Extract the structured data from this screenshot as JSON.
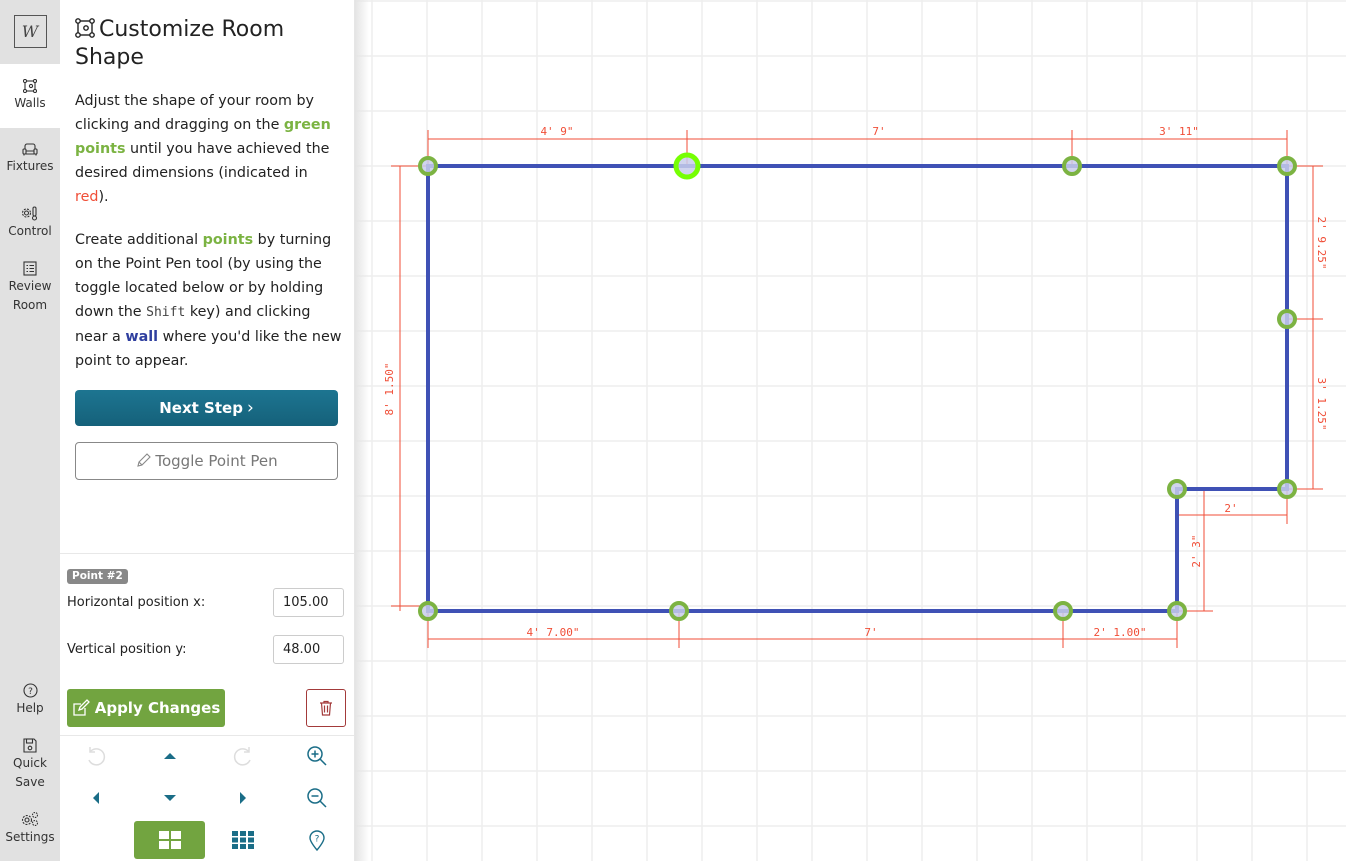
{
  "rail": {
    "logo_text": "W",
    "items": [
      {
        "label": "Walls",
        "icon": "walls-icon",
        "active": true
      },
      {
        "label": "Fixtures",
        "icon": "sofa-icon"
      },
      {
        "label": "Control",
        "icon": "thermostat-gear-icon"
      },
      {
        "label": "Review Room",
        "icon": "checklist-icon"
      }
    ],
    "bottom_items": [
      {
        "label": "Help",
        "icon": "question-circle-icon"
      },
      {
        "label": "Quick Save",
        "icon": "floppy-disk-icon"
      },
      {
        "label": "Settings",
        "icon": "gears-icon"
      }
    ]
  },
  "panel": {
    "title": "Customize Room Shape",
    "intro": {
      "p1_a": "Adjust the shape of your room by clicking and dragging on the ",
      "p1_green": "green points",
      "p1_b": " until you have achieved the desired dimensions (indicated in ",
      "p1_red": "red",
      "p1_c": ").",
      "p2_a": "Create additional ",
      "p2_green": "points",
      "p2_b": " by turning on the Point Pen tool (by using the toggle located below or by holding down the ",
      "p2_key": "Shift",
      "p2_c": " key) and clicking near a ",
      "p2_blue": "wall",
      "p2_d": " where you'd like the new point to appear."
    },
    "next_button": "Next Step",
    "next_chevron": "›",
    "toggle_button": "Toggle Point Pen",
    "point_badge": "Point #2",
    "x_label": "Horizontal position x:",
    "x_value": "105.00",
    "y_label": "Vertical position y:",
    "y_value": "48.00",
    "apply_button": "Apply Changes",
    "colors": {
      "next_button": "#1a6d87",
      "apply_button": "#72a440",
      "green_text": "#7bb342",
      "red_text": "#f04e37",
      "wall_text": "#2f3f9f"
    }
  },
  "controls": [
    {
      "name": "undo-button",
      "icon": "undo-icon",
      "enabled": false
    },
    {
      "name": "pan-up-button",
      "icon": "caret-up-icon",
      "enabled": true
    },
    {
      "name": "redo-button",
      "icon": "redo-icon",
      "enabled": false
    },
    {
      "name": "zoom-in-button",
      "icon": "zoom-in-icon",
      "enabled": true
    },
    {
      "name": "pan-left-button",
      "icon": "caret-left-icon",
      "enabled": true
    },
    {
      "name": "pan-down-button",
      "icon": "caret-down-icon",
      "enabled": true
    },
    {
      "name": "pan-right-button",
      "icon": "caret-right-icon",
      "enabled": true
    },
    {
      "name": "zoom-out-button",
      "icon": "zoom-out-icon",
      "enabled": true
    },
    {
      "name": "large-grid-button",
      "icon": "grid-2x2-icon",
      "active": true
    },
    {
      "name": "small-grid-button",
      "icon": "grid-3x3-icon"
    },
    {
      "name": "location-help-button",
      "icon": "map-pin-question-icon"
    }
  ],
  "floorplan": {
    "colors": {
      "wall": "#3f51b5",
      "point": "#7cb342",
      "selected_point": "#76ff03",
      "dimension": "#f04e37",
      "grid": "#eeeeee"
    },
    "selected_point": 2,
    "points_count": 11,
    "dimensions": {
      "top": [
        "4' 9\"",
        "7'",
        "3' 11\""
      ],
      "right": [
        "2' 9.25\"",
        "3' 1.25\""
      ],
      "notch_horizontal": "2'",
      "notch_vertical": "2' 3\"",
      "bottom": [
        "4' 7.00\"",
        "7'",
        "2' 1.00\""
      ],
      "left": "8' 1.50\""
    }
  }
}
